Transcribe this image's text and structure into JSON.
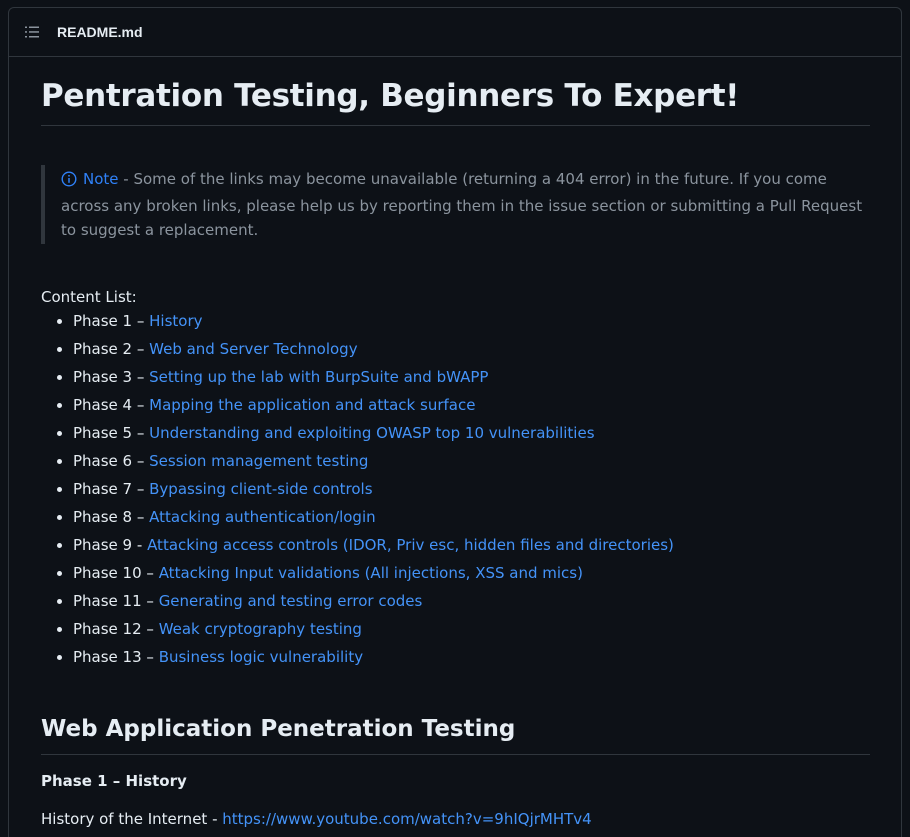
{
  "file": {
    "name": "README.md"
  },
  "readme": {
    "title": "Pentration Testing, Beginners To Expert!",
    "note": {
      "title": "Note",
      "text": " - Some of the links may become unavailable (returning a 404 error) in the future. If you come across any broken links, please help us by reporting them in the issue section or submitting a Pull Request to suggest a replacement."
    },
    "content_label": "Content List:",
    "phases": [
      {
        "prefix": "Phase 1 – ",
        "link": "History"
      },
      {
        "prefix": "Phase 2 – ",
        "link": "Web and Server Technology"
      },
      {
        "prefix": "Phase 3 – ",
        "link": "Setting up the lab with BurpSuite and bWAPP"
      },
      {
        "prefix": "Phase 4 – ",
        "link": "Mapping the application and attack surface"
      },
      {
        "prefix": "Phase 5 – ",
        "link": "Understanding and exploiting OWASP top 10 vulnerabilities"
      },
      {
        "prefix": "Phase 6 – ",
        "link": "Session management testing"
      },
      {
        "prefix": "Phase 7 – ",
        "link": "Bypassing client-side controls"
      },
      {
        "prefix": "Phase 8 – ",
        "link": "Attacking authentication/login"
      },
      {
        "prefix": "Phase 9 - ",
        "link": "Attacking access controls (IDOR, Priv esc, hidden files and directories)"
      },
      {
        "prefix": "Phase 10 – ",
        "link": "Attacking Input validations (All injections, XSS and mics)"
      },
      {
        "prefix": "Phase 11 – ",
        "link": "Generating and testing error codes"
      },
      {
        "prefix": "Phase 12 – ",
        "link": "Weak cryptography testing"
      },
      {
        "prefix": "Phase 13 – ",
        "link": "Business logic vulnerability"
      }
    ],
    "section_title": "Web Application Penetration Testing",
    "phase1_heading": "Phase 1 – History",
    "history_line": {
      "label": "History of the Internet - ",
      "url": "https://www.youtube.com/watch?v=9hIQjrMHTv4"
    }
  },
  "icons": {
    "toc": "list-unordered-icon",
    "note": "info-icon"
  },
  "colors": {
    "background": "#0d1117",
    "border": "#30363d",
    "text": "#e6edf3",
    "muted": "#8b949e",
    "link": "#4493f8",
    "note_accent": "#2f81f7"
  }
}
